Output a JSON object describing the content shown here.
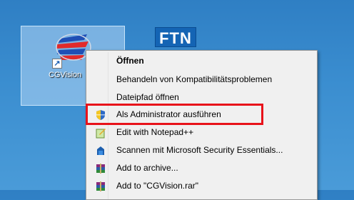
{
  "desktop": {
    "icons": [
      {
        "label": "CGVision"
      },
      {
        "label": "FTN"
      }
    ]
  },
  "context_menu": {
    "items": [
      {
        "label": "Öffnen",
        "icon": "none",
        "bold": true
      },
      {
        "label": "Behandeln von Kompatibilitätsproblemen",
        "icon": "none"
      },
      {
        "label": "Dateipfad öffnen",
        "icon": "none"
      },
      {
        "label": "Als Administrator ausführen",
        "icon": "uac-shield-icon"
      },
      {
        "label": "Edit with Notepad++",
        "icon": "notepad-plus-plus-icon"
      },
      {
        "label": "Scannen mit Microsoft Security Essentials...",
        "icon": "security-essentials-icon"
      },
      {
        "label": "Add to archive...",
        "icon": "winrar-icon"
      },
      {
        "label": "Add to \"CGVision.rar\"",
        "icon": "winrar-icon"
      }
    ]
  },
  "colors": {
    "desktop_bg": "#3b8ed0",
    "highlight": "#e8121a"
  }
}
